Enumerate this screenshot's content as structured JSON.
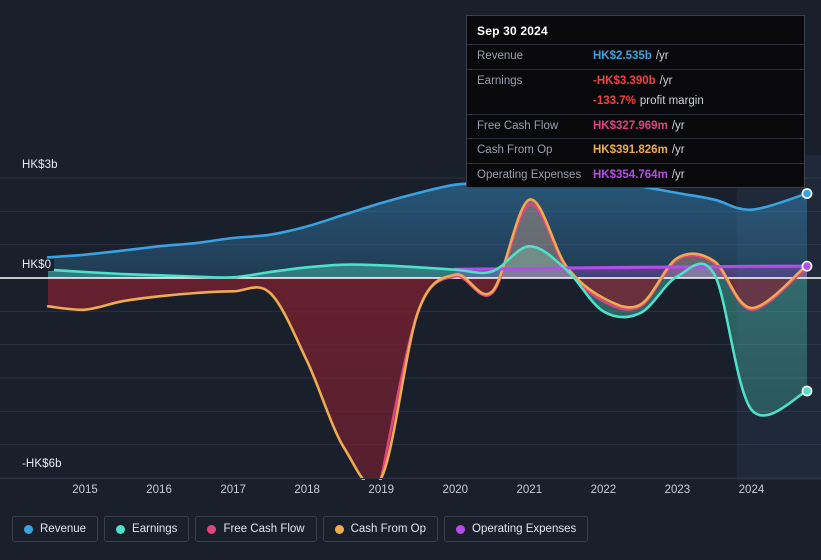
{
  "colors": {
    "revenue": "#3aa2e0",
    "earnings": "#4ee0c8",
    "free_cash_flow": "#e0447f",
    "cash_from_op": "#eeab50",
    "operating_expenses": "#b44ce8",
    "background": "#1a1f2c",
    "zero_line": "#ffffff",
    "grid": "#2b3040",
    "negative_fill": "#7a2030",
    "tooltip_bg": "#09090b",
    "tooltip_border": "#3c4050"
  },
  "tooltip": {
    "title": "Sep 30 2024",
    "rows": [
      {
        "label": "Revenue",
        "value": "HK$2.535b",
        "suffix": "/yr",
        "color": "#3aa2e0"
      },
      {
        "label": "Earnings",
        "value": "-HK$3.390b",
        "suffix": "/yr",
        "color": "#ef4444"
      },
      {
        "label": "",
        "value": "-133.7%",
        "suffix": "profit margin",
        "color": "#ef4444",
        "sub": true
      },
      {
        "label": "Free Cash Flow",
        "value": "HK$327.969m",
        "suffix": "/yr",
        "color": "#e0447f"
      },
      {
        "label": "Cash From Op",
        "value": "HK$391.826m",
        "suffix": "/yr",
        "color": "#eeab50"
      },
      {
        "label": "Operating Expenses",
        "value": "HK$354.764m",
        "suffix": "/yr",
        "color": "#b44ce8"
      }
    ]
  },
  "legend": [
    {
      "label": "Revenue",
      "color": "#3aa2e0"
    },
    {
      "label": "Earnings",
      "color": "#4ee0c8"
    },
    {
      "label": "Free Cash Flow",
      "color": "#e0447f"
    },
    {
      "label": "Cash From Op",
      "color": "#eeab50"
    },
    {
      "label": "Operating Expenses",
      "color": "#b44ce8"
    }
  ],
  "axis": {
    "y_top_label": "HK$3b",
    "y_zero_label": "HK$0",
    "y_bottom_label": "-HK$6b",
    "x_ticks": [
      "2015",
      "2016",
      "2017",
      "2018",
      "2019",
      "2020",
      "2021",
      "2022",
      "2023",
      "2024"
    ]
  },
  "chart_data": {
    "type": "area",
    "title": "",
    "xlabel": "",
    "ylabel": "HK$",
    "ylim": [
      -6,
      3
    ],
    "grid": true,
    "legend_position": "bottom",
    "currency": "HKD",
    "units": "billions",
    "x": [
      2014.5,
      2015.0,
      2015.5,
      2016.0,
      2016.5,
      2017.0,
      2017.5,
      2018.0,
      2018.5,
      2019.0,
      2019.5,
      2020.0,
      2020.5,
      2021.0,
      2021.5,
      2022.0,
      2022.5,
      2023.0,
      2023.5,
      2024.0,
      2024.75
    ],
    "x_tick_values": [
      2015,
      2016,
      2017,
      2018,
      2019,
      2020,
      2021,
      2022,
      2023,
      2024
    ],
    "series": [
      {
        "name": "Revenue",
        "color": "#3aa2e0",
        "values": [
          0.62,
          0.7,
          0.82,
          0.95,
          1.05,
          1.2,
          1.3,
          1.55,
          1.9,
          2.25,
          2.55,
          2.8,
          2.85,
          2.9,
          2.95,
          2.95,
          2.75,
          2.55,
          2.35,
          2.05,
          2.535
        ]
      },
      {
        "name": "Earnings",
        "color": "#4ee0c8",
        "values": [
          0.25,
          0.18,
          0.12,
          0.08,
          0.04,
          0.02,
          0.18,
          0.32,
          0.4,
          0.38,
          0.32,
          0.25,
          0.2,
          0.95,
          0.25,
          -1.0,
          -1.05,
          0.05,
          0.1,
          -3.95,
          -3.39
        ]
      },
      {
        "name": "Free Cash Flow",
        "color": "#e0447f",
        "values": [
          null,
          null,
          null,
          null,
          null,
          null,
          null,
          null,
          null,
          -6.0,
          -1.0,
          0.05,
          -0.45,
          2.2,
          0.3,
          -0.7,
          -0.85,
          0.55,
          0.45,
          -0.95,
          0.328
        ]
      },
      {
        "name": "Cash From Op",
        "color": "#eeab50",
        "values": [
          -0.85,
          -0.95,
          -0.7,
          -0.55,
          -0.45,
          -0.4,
          -0.45,
          -2.5,
          -5.1,
          -6.0,
          -1.0,
          0.1,
          -0.4,
          2.35,
          0.35,
          -0.6,
          -0.8,
          0.6,
          0.5,
          -0.9,
          0.392
        ]
      },
      {
        "name": "Operating Expenses",
        "color": "#b44ce8",
        "values": [
          null,
          null,
          null,
          null,
          null,
          null,
          null,
          null,
          null,
          null,
          null,
          0.26,
          0.27,
          0.28,
          0.3,
          0.31,
          0.32,
          0.33,
          0.34,
          0.35,
          0.355
        ]
      }
    ],
    "end_markers": [
      {
        "name": "Revenue",
        "value": 2.535,
        "color": "#3aa2e0"
      },
      {
        "name": "Operating Expenses",
        "value": 0.355,
        "color": "#b44ce8"
      },
      {
        "name": "Earnings",
        "value": -3.39,
        "color": "#4ee0c8"
      }
    ]
  }
}
